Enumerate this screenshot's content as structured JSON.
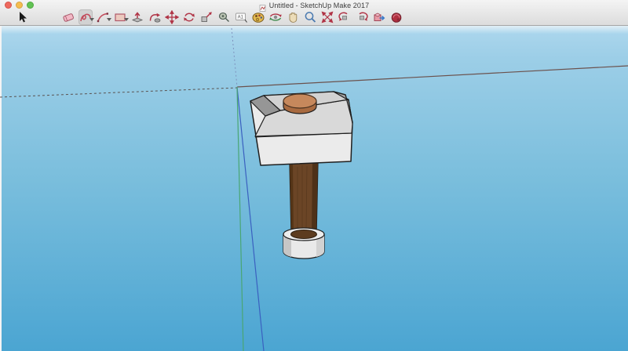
{
  "window": {
    "title": "Untitled - SketchUp Make 2017",
    "traffic_lights": [
      "close",
      "minimize",
      "fullscreen"
    ]
  },
  "toolbar": {
    "tools": [
      {
        "name": "select",
        "label": "Select"
      },
      {
        "name": "eraser",
        "label": "Eraser"
      },
      {
        "name": "freehand",
        "label": "Freehand",
        "active": true,
        "has_dropdown": true
      },
      {
        "name": "arc",
        "label": "2 Point Arc",
        "has_dropdown": true
      },
      {
        "name": "rectangle",
        "label": "Rectangle",
        "has_dropdown": true
      },
      {
        "name": "push-pull",
        "label": "Push/Pull"
      },
      {
        "name": "follow-me",
        "label": "Follow Me"
      },
      {
        "name": "move",
        "label": "Move"
      },
      {
        "name": "rotate",
        "label": "Rotate"
      },
      {
        "name": "scale",
        "label": "Scale"
      },
      {
        "name": "tape-measure",
        "label": "Tape Measure"
      },
      {
        "name": "text",
        "label": "Text",
        "glyph": "A1"
      },
      {
        "name": "paint-bucket",
        "label": "Paint Bucket"
      },
      {
        "name": "orbit",
        "label": "Orbit"
      },
      {
        "name": "pan",
        "label": "Pan"
      },
      {
        "name": "zoom",
        "label": "Zoom"
      },
      {
        "name": "zoom-extents",
        "label": "Zoom Extents"
      },
      {
        "name": "previous",
        "label": "Previous"
      },
      {
        "name": "next",
        "label": "Next"
      },
      {
        "name": "get-models",
        "label": "Get Models"
      },
      {
        "name": "extension-warehouse",
        "label": "Extension Warehouse"
      }
    ]
  },
  "viewport": {
    "model": "mallet hammer with metal head, copper cap, wooden handle and ferrule",
    "active_tool": "Freehand"
  },
  "colors": {
    "sky_top": "#a9d5ec",
    "sky_bottom": "#4ba5d2",
    "axis_red_solid": "#6b514d",
    "axis_red_dashed": "#5a5250",
    "axis_green_solid": "#49a673",
    "axis_blue_solid": "#3a60c0",
    "axis_blue_dashed": "#7d92bd",
    "head_front": "#ebebeb",
    "head_top": "#d2d2d2",
    "head_chamfer": "#d9d9d9",
    "head_bevel_dark": "#969696",
    "head_right": "#a3a3a3",
    "copper_top": "#c6885c",
    "copper_side": "#a86a40",
    "handle_brown": "#6b4526",
    "handle_dark": "#4e3118",
    "collar_white": "#e9e9e9",
    "collar_rim": "#ededed",
    "handle_end": "#5d3c1f",
    "outline": "#1f1f1f"
  }
}
